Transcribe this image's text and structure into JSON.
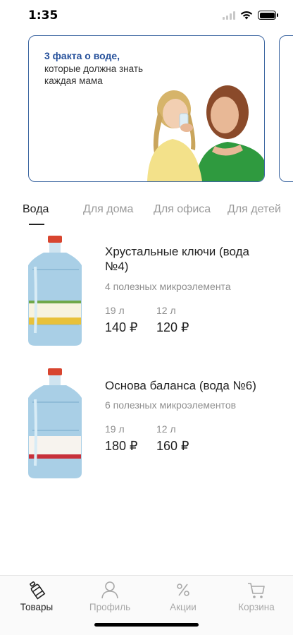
{
  "status": {
    "time": "1:35"
  },
  "banner": {
    "title": "3 факта о воде,",
    "subtitle": "которые должна знать каждая мама"
  },
  "tabs": [
    {
      "label": "Вода",
      "active": true
    },
    {
      "label": "Для дома",
      "active": false
    },
    {
      "label": "Для офиса",
      "active": false
    },
    {
      "label": "Для детей",
      "active": false
    }
  ],
  "products": [
    {
      "name": "Хрустальные ключи (вода №4)",
      "description": "4 полезных микроэлемента",
      "options": [
        {
          "volume": "19 л",
          "price": "140 ₽"
        },
        {
          "volume": "12 л",
          "price": "120 ₽"
        }
      ],
      "label_color": "#e8c13a"
    },
    {
      "name": "Основа баланса (вода №6)",
      "description": "6 полезных микроэлементов",
      "options": [
        {
          "volume": "19 л",
          "price": "180 ₽"
        },
        {
          "volume": "12 л",
          "price": "160 ₽"
        }
      ],
      "label_color": "#c8303a"
    }
  ],
  "bottom_nav": [
    {
      "label": "Товары",
      "icon": "bottle-icon",
      "active": true
    },
    {
      "label": "Профиль",
      "icon": "person-icon",
      "active": false
    },
    {
      "label": "Акции",
      "icon": "percent-icon",
      "active": false
    },
    {
      "label": "Корзина",
      "icon": "cart-icon",
      "active": false
    }
  ],
  "colors": {
    "accent": "#244f9a",
    "banner_border": "#3a64a0",
    "muted": "#8e8e8e"
  }
}
